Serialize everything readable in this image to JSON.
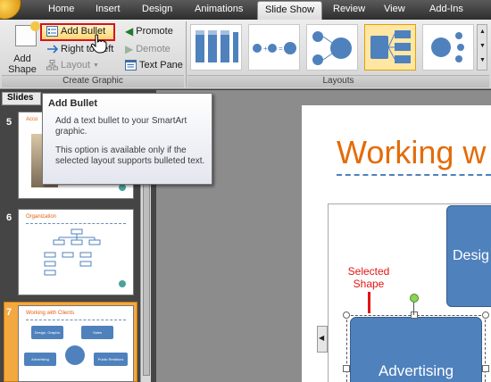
{
  "tabs": [
    {
      "label": "Home",
      "active": false
    },
    {
      "label": "Insert",
      "active": false
    },
    {
      "label": "Design",
      "active": true
    },
    {
      "label": "Animations",
      "active": false
    },
    {
      "label": "Slide Show",
      "active": false
    },
    {
      "label": "Review",
      "active": false
    },
    {
      "label": "View",
      "active": false
    },
    {
      "label": "Add-Ins",
      "active": false
    }
  ],
  "ribbon": {
    "create_graphic": {
      "add_shape_label": "Add Shape",
      "add_bullet_label": "Add Bullet",
      "right_to_left_label": "Right to Left",
      "layout_label": "Layout",
      "promote_label": "Promote",
      "demote_label": "Demote",
      "text_pane_label": "Text Pane",
      "group_label": "Create Graphic"
    },
    "layouts": {
      "group_label": "Layouts"
    }
  },
  "slides_pane": {
    "tab_label": "Slides",
    "slides": [
      {
        "number": "5",
        "title": "Acco"
      },
      {
        "number": "6",
        "title": "Organization"
      },
      {
        "number": "7",
        "title": "Working with Clients",
        "labels": [
          "Design, Graphic",
          "Sales",
          "Advertising",
          "Public Relations"
        ]
      }
    ]
  },
  "tooltip": {
    "title": "Add Bullet",
    "description": "Add a text bullet to your SmartArt graphic.",
    "note": "This option is available only if the selected layout supports bulleted text."
  },
  "slide": {
    "title": "Working w",
    "shape_top_label": "Desig",
    "shape_selected_label": "Advertising",
    "callout": "Selected Shape"
  },
  "colors": {
    "accent_orange": "#e36c09",
    "shape_blue": "#4f81bd",
    "callout_red": "#e21515",
    "highlight_red": "#d8111f"
  }
}
